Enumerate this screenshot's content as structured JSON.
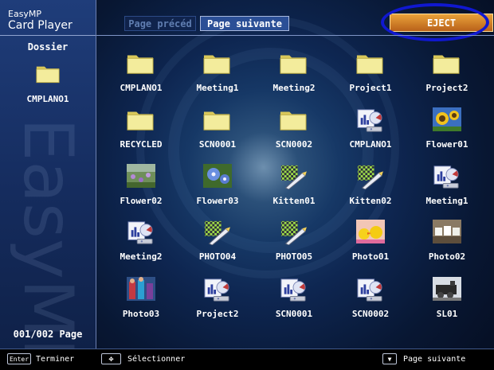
{
  "app": {
    "logo_line1": "EasyMP",
    "logo_line2": "Card Player",
    "watermark": "EasyMP"
  },
  "sidebar": {
    "title": "Dossier",
    "folder_label": "CMPLANO1",
    "folder_icon": "folder-icon",
    "page_counter": "001/002 Page"
  },
  "toolbar": {
    "prev_label": "Page précéd",
    "next_label": "Page suivante",
    "eject_label": "EJECT",
    "eject_highlight_color": "#1018d0"
  },
  "items": [
    {
      "label": "CMPLANO1",
      "icon": "folder"
    },
    {
      "label": "Meeting1",
      "icon": "folder"
    },
    {
      "label": "Meeting2",
      "icon": "folder"
    },
    {
      "label": "Project1",
      "icon": "folder"
    },
    {
      "label": "Project2",
      "icon": "folder"
    },
    {
      "label": "RECYCLED",
      "icon": "folder"
    },
    {
      "label": "SCN0001",
      "icon": "folder"
    },
    {
      "label": "SCN0002",
      "icon": "folder"
    },
    {
      "label": "CMPLANO1",
      "icon": "presentation"
    },
    {
      "label": "Flower01",
      "icon": "photo-sunflower"
    },
    {
      "label": "Flower02",
      "icon": "photo-garden"
    },
    {
      "label": "Flower03",
      "icon": "photo-blueflower"
    },
    {
      "label": "Kitten01",
      "icon": "image-file"
    },
    {
      "label": "Kitten02",
      "icon": "image-file"
    },
    {
      "label": "Meeting1",
      "icon": "presentation"
    },
    {
      "label": "Meeting2",
      "icon": "presentation"
    },
    {
      "label": "PHOTO04",
      "icon": "image-file"
    },
    {
      "label": "PHOTO05",
      "icon": "image-file"
    },
    {
      "label": "Photo01",
      "icon": "photo-ducks"
    },
    {
      "label": "Photo02",
      "icon": "photo-cups"
    },
    {
      "label": "Photo03",
      "icon": "photo-people"
    },
    {
      "label": "Project2",
      "icon": "presentation"
    },
    {
      "label": "SCN0001",
      "icon": "presentation"
    },
    {
      "label": "SCN0002",
      "icon": "presentation"
    },
    {
      "label": "SL01",
      "icon": "photo-train"
    }
  ],
  "bottom": {
    "enter_key": "Enter",
    "enter_hint": "Terminer",
    "select_key": "✥",
    "select_hint": "Sélectionner",
    "next_key": "▼",
    "next_hint": "Page suivante"
  }
}
